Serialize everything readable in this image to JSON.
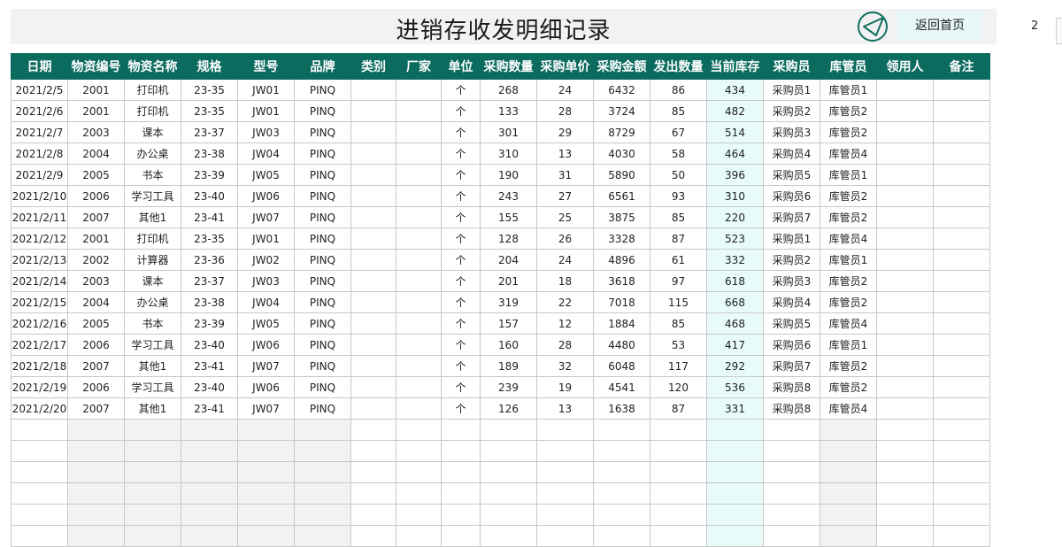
{
  "title": "进销存收发明细记录",
  "home_button": "返回首页",
  "page_number": "2",
  "colors": {
    "header_bg": "#0b6b5f",
    "accent_stock": "#e8fbfb",
    "shade": "#f2f2f2",
    "logo": "#0f6e60"
  },
  "columns": [
    "日期",
    "物资编号",
    "物资名称",
    "规格",
    "型号",
    "品牌",
    "类别",
    "厂家",
    "单位",
    "采购数量",
    "采购单价",
    "采购金额",
    "发出数量",
    "当前库存",
    "采购员",
    "库管员",
    "领用人",
    "备注"
  ],
  "rows": [
    [
      "2021/2/5",
      "2001",
      "打印机",
      "23-35",
      "JW01",
      "PINQ",
      "",
      "",
      "个",
      "268",
      "24",
      "6432",
      "86",
      "434",
      "采购员1",
      "库管员1",
      "",
      ""
    ],
    [
      "2021/2/6",
      "2001",
      "打印机",
      "23-35",
      "JW01",
      "PINQ",
      "",
      "",
      "个",
      "133",
      "28",
      "3724",
      "85",
      "482",
      "采购员2",
      "库管员2",
      "",
      ""
    ],
    [
      "2021/2/7",
      "2003",
      "课本",
      "23-37",
      "JW03",
      "PINQ",
      "",
      "",
      "个",
      "301",
      "29",
      "8729",
      "67",
      "514",
      "采购员3",
      "库管员2",
      "",
      ""
    ],
    [
      "2021/2/8",
      "2004",
      "办公桌",
      "23-38",
      "JW04",
      "PINQ",
      "",
      "",
      "个",
      "310",
      "13",
      "4030",
      "58",
      "464",
      "采购员4",
      "库管员4",
      "",
      ""
    ],
    [
      "2021/2/9",
      "2005",
      "书本",
      "23-39",
      "JW05",
      "PINQ",
      "",
      "",
      "个",
      "190",
      "31",
      "5890",
      "50",
      "396",
      "采购员5",
      "库管员1",
      "",
      ""
    ],
    [
      "2021/2/10",
      "2006",
      "学习工具",
      "23-40",
      "JW06",
      "PINQ",
      "",
      "",
      "个",
      "243",
      "27",
      "6561",
      "93",
      "310",
      "采购员6",
      "库管员2",
      "",
      ""
    ],
    [
      "2021/2/11",
      "2007",
      "其他1",
      "23-41",
      "JW07",
      "PINQ",
      "",
      "",
      "个",
      "155",
      "25",
      "3875",
      "85",
      "220",
      "采购员7",
      "库管员2",
      "",
      ""
    ],
    [
      "2021/2/12",
      "2001",
      "打印机",
      "23-35",
      "JW01",
      "PINQ",
      "",
      "",
      "个",
      "128",
      "26",
      "3328",
      "87",
      "523",
      "采购员1",
      "库管员4",
      "",
      ""
    ],
    [
      "2021/2/13",
      "2002",
      "计算器",
      "23-36",
      "JW02",
      "PINQ",
      "",
      "",
      "个",
      "204",
      "24",
      "4896",
      "61",
      "332",
      "采购员2",
      "库管员1",
      "",
      ""
    ],
    [
      "2021/2/14",
      "2003",
      "课本",
      "23-37",
      "JW03",
      "PINQ",
      "",
      "",
      "个",
      "201",
      "18",
      "3618",
      "97",
      "618",
      "采购员3",
      "库管员2",
      "",
      ""
    ],
    [
      "2021/2/15",
      "2004",
      "办公桌",
      "23-38",
      "JW04",
      "PINQ",
      "",
      "",
      "个",
      "319",
      "22",
      "7018",
      "115",
      "668",
      "采购员4",
      "库管员2",
      "",
      ""
    ],
    [
      "2021/2/16",
      "2005",
      "书本",
      "23-39",
      "JW05",
      "PINQ",
      "",
      "",
      "个",
      "157",
      "12",
      "1884",
      "85",
      "468",
      "采购员5",
      "库管员4",
      "",
      ""
    ],
    [
      "2021/2/17",
      "2006",
      "学习工具",
      "23-40",
      "JW06",
      "PINQ",
      "",
      "",
      "个",
      "160",
      "28",
      "4480",
      "53",
      "417",
      "采购员6",
      "库管员1",
      "",
      ""
    ],
    [
      "2021/2/18",
      "2007",
      "其他1",
      "23-41",
      "JW07",
      "PINQ",
      "",
      "",
      "个",
      "189",
      "32",
      "6048",
      "117",
      "292",
      "采购员7",
      "库管员2",
      "",
      ""
    ],
    [
      "2021/2/19",
      "2006",
      "学习工具",
      "23-40",
      "JW06",
      "PINQ",
      "",
      "",
      "个",
      "239",
      "19",
      "4541",
      "120",
      "536",
      "采购员8",
      "库管员2",
      "",
      ""
    ],
    [
      "2021/2/20",
      "2007",
      "其他1",
      "23-41",
      "JW07",
      "PINQ",
      "",
      "",
      "个",
      "126",
      "13",
      "1638",
      "87",
      "331",
      "采购员8",
      "库管员4",
      "",
      ""
    ],
    [
      "",
      "",
      "",
      "",
      "",
      "",
      "",
      "",
      "",
      "",
      "",
      "",
      "",
      "",
      "",
      "",
      "",
      ""
    ],
    [
      "",
      "",
      "",
      "",
      "",
      "",
      "",
      "",
      "",
      "",
      "",
      "",
      "",
      "",
      "",
      "",
      "",
      ""
    ],
    [
      "",
      "",
      "",
      "",
      "",
      "",
      "",
      "",
      "",
      "",
      "",
      "",
      "",
      "",
      "",
      "",
      "",
      ""
    ],
    [
      "",
      "",
      "",
      "",
      "",
      "",
      "",
      "",
      "",
      "",
      "",
      "",
      "",
      "",
      "",
      "",
      "",
      ""
    ],
    [
      "",
      "",
      "",
      "",
      "",
      "",
      "",
      "",
      "",
      "",
      "",
      "",
      "",
      "",
      "",
      "",
      "",
      ""
    ],
    [
      "",
      "",
      "",
      "",
      "",
      "",
      "",
      "",
      "",
      "",
      "",
      "",
      "",
      "",
      "",
      "",
      "",
      ""
    ]
  ]
}
